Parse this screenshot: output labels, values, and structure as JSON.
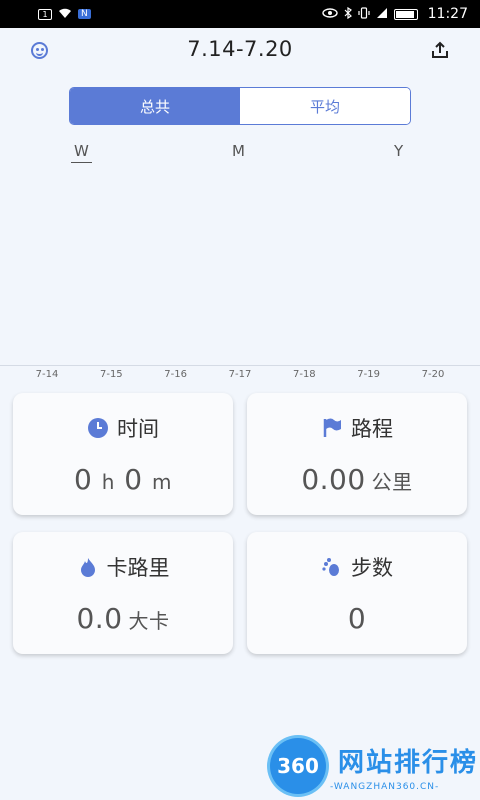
{
  "status_bar": {
    "sim_label": "1",
    "badge": "N",
    "time": "11:27"
  },
  "header": {
    "title": "7.14-7.20",
    "left_icon": "smiley-icon",
    "right_icon": "share-icon"
  },
  "segment": {
    "options": [
      "总共",
      "平均"
    ],
    "selected": "总共"
  },
  "periods": {
    "items": [
      "W",
      "M",
      "Y"
    ],
    "selected": "W"
  },
  "chart_data": {
    "type": "bar",
    "categories": [
      "7-14",
      "7-15",
      "7-16",
      "7-17",
      "7-18",
      "7-19",
      "7-20"
    ],
    "values": [
      0,
      0,
      0,
      0,
      0,
      0,
      0
    ]
  },
  "cards": {
    "time": {
      "title": "时间",
      "icon": "clock-icon",
      "hours": "0",
      "h_unit": "h",
      "minutes": "0",
      "m_unit": "m"
    },
    "distance": {
      "title": "路程",
      "icon": "flag-icon",
      "value": "0.00",
      "unit": "公里"
    },
    "calories": {
      "title": "卡路里",
      "icon": "flame-icon",
      "value": "0.0",
      "unit": "大卡"
    },
    "steps": {
      "title": "步数",
      "icon": "footprint-icon",
      "value": "0"
    }
  },
  "colors": {
    "accent": "#5b7bd6",
    "background": "#f2f6fc"
  },
  "watermark": {
    "logo_text": "360",
    "text": "网站排行榜",
    "sub": "-WANGZHAN360.CN-"
  }
}
